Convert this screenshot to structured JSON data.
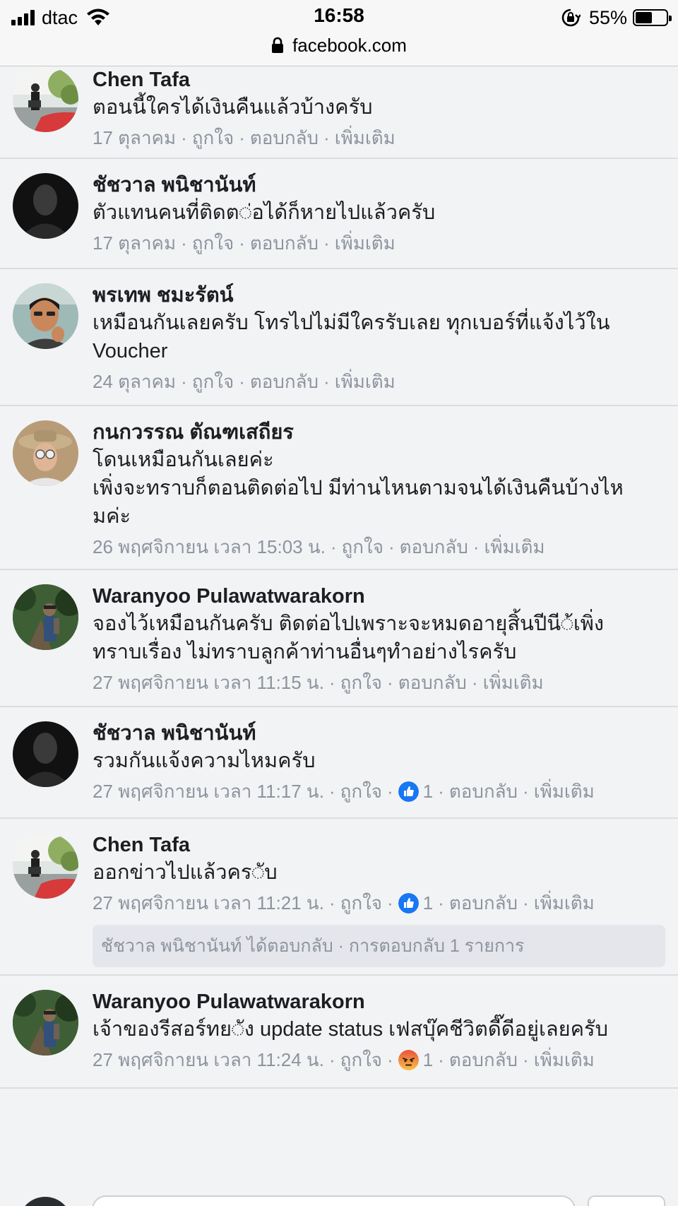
{
  "status_bar": {
    "carrier": "dtac",
    "time": "16:58",
    "battery": "55%",
    "battery_level": 0.55,
    "signal_bars": 4
  },
  "browser": {
    "url": "facebook.com"
  },
  "actions": {
    "like": "ถูกใจ",
    "reply": "ตอบกลับ",
    "more": "เพิ่มเติม"
  },
  "comments": [
    {
      "name": "Chen Tafa",
      "text_lines": [
        "ตอนนี้ใครได้เงินคืนแล้วบ้างครับ"
      ],
      "time": "17 ตุลาคม",
      "avatar": "street-photo-avatar"
    },
    {
      "name": "ชัชวาล พนิชานันท์",
      "text_lines": [
        "ตัวแทนคนที่ติดต◌่อได้ก็หายไปแล้วครับ"
      ],
      "time": "17 ตุลาคม",
      "avatar": "silhouette-avatar"
    },
    {
      "name": "พรเทพ ชมะรัตน์",
      "text_lines": [
        "เหมือนกันเลยครับ โทรไปไม่มีใครรับเลย ทุกเบอร์ที่แจ้งไว้ใน",
        "Voucher"
      ],
      "time": "24 ตุลาคม",
      "avatar": "portrait-avatar"
    },
    {
      "name": "กนกวรรณ ตัณฑเสถียร",
      "text_lines": [
        "โดนเหมือนกันเลยค่ะ",
        "เพิ่งจะทราบก็ตอนติดต่อไป มีท่านไหนตามจนได้เงินคืนบ้างไห",
        "มค่ะ"
      ],
      "time": "26 พฤศจิกายน เวลา 15:03 น.",
      "avatar": "hat-avatar"
    },
    {
      "name": "Waranyoo Pulawatwarakorn",
      "text_lines": [
        "จองไว้เหมือนกันครับ ติดต่อไปเพราะจะหมดอายุสิ้นปีนี◌้เพิ่ง",
        "ทราบเรื่อง ไม่ทราบลูกค้าท่านอื่นๆทำอย่างไรครับ"
      ],
      "time": "27 พฤศจิกายน เวลา 11:15 น.",
      "avatar": "forest-avatar"
    },
    {
      "name": "ชัชวาล พนิชานันท์",
      "text_lines": [
        "รวมกันแจ้งความไหมครับ"
      ],
      "time": "27 พฤศจิกายน เวลา 11:17 น.",
      "avatar": "silhouette-avatar",
      "reaction": {
        "icon": "thumbs-up-icon",
        "count": "1",
        "color": "#1877f2"
      }
    },
    {
      "name": "Chen Tafa",
      "text_lines": [
        "ออกข่าวไปแล้วคร◌ับ"
      ],
      "time": "27 พฤศจิกายน เวลา 11:21 น.",
      "avatar": "street-photo-avatar",
      "reaction": {
        "icon": "thumbs-up-icon",
        "count": "1",
        "color": "#1877f2"
      },
      "replies_summary": "ชัชวาล พนิชานันท์ ได้ตอบกลับ · การตอบกลับ 1 รายการ"
    },
    {
      "name": "Waranyoo Pulawatwarakorn",
      "text_lines": [
        "เจ้าของรีสอร์ทย◌ัง update status เฟสบุ๊คชีวิตดี๊ดีอยู่เลยครับ"
      ],
      "time": "27 พฤศจิกายน เวลา 11:24 น.",
      "avatar": "forest-avatar",
      "reaction": {
        "icon": "angry-face-icon",
        "count": "1",
        "color": "#f7714c"
      }
    }
  ]
}
